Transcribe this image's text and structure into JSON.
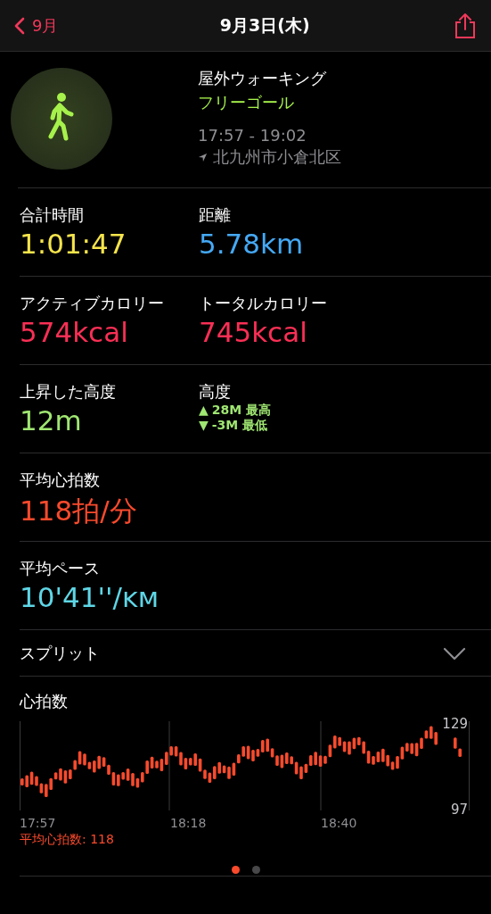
{
  "header": {
    "back_label": "9月",
    "title": "9月3日(木)"
  },
  "workout": {
    "name": "屋外ウォーキング",
    "goal": "フリーゴール",
    "time_range": "17:57 - 19:02",
    "location": "北九州市小倉北区"
  },
  "metric_rows": [
    {
      "cells": [
        {
          "kind": "value",
          "label": "合計時間",
          "value": "1:01:47",
          "color": "#f5e44b"
        },
        {
          "kind": "value",
          "label": "距離",
          "value": "5.78km",
          "color": "#45a9f5"
        }
      ]
    },
    {
      "cells": [
        {
          "kind": "value",
          "label": "アクティブカロリー",
          "value": "574kcal",
          "color": "#fa2f55"
        },
        {
          "kind": "value",
          "label": "トータルカロリー",
          "value": "745kcal",
          "color": "#fa2f55"
        }
      ]
    },
    {
      "cells": [
        {
          "kind": "value",
          "label": "上昇した高度",
          "value": "12m",
          "color": "#9fe672"
        },
        {
          "kind": "range",
          "label": "高度",
          "color": "#9fe672",
          "lines": [
            {
              "arrow": "▲",
              "text": "28M 最高"
            },
            {
              "arrow": "▼",
              "text": "-3M 最低"
            }
          ]
        }
      ]
    },
    {
      "cells": [
        {
          "kind": "value",
          "label": "平均心拍数",
          "value": "118拍/分",
          "color": "#fa4a2c"
        }
      ]
    },
    {
      "cells": [
        {
          "kind": "value",
          "label": "平均ペース",
          "value": "10'41''/ĸм",
          "color": "#5ed6e6"
        }
      ]
    }
  ],
  "split": {
    "label": "スプリット",
    "expanded": false
  },
  "heart_chart": {
    "title": "心拍数",
    "y_labels": [
      "129",
      "97"
    ],
    "x_labels": [
      "17:57",
      "18:18",
      "18:40"
    ],
    "average": "平均心拍数: 118"
  },
  "pages": [
    {
      "selected": true
    },
    {
      "selected": false
    }
  ]
}
